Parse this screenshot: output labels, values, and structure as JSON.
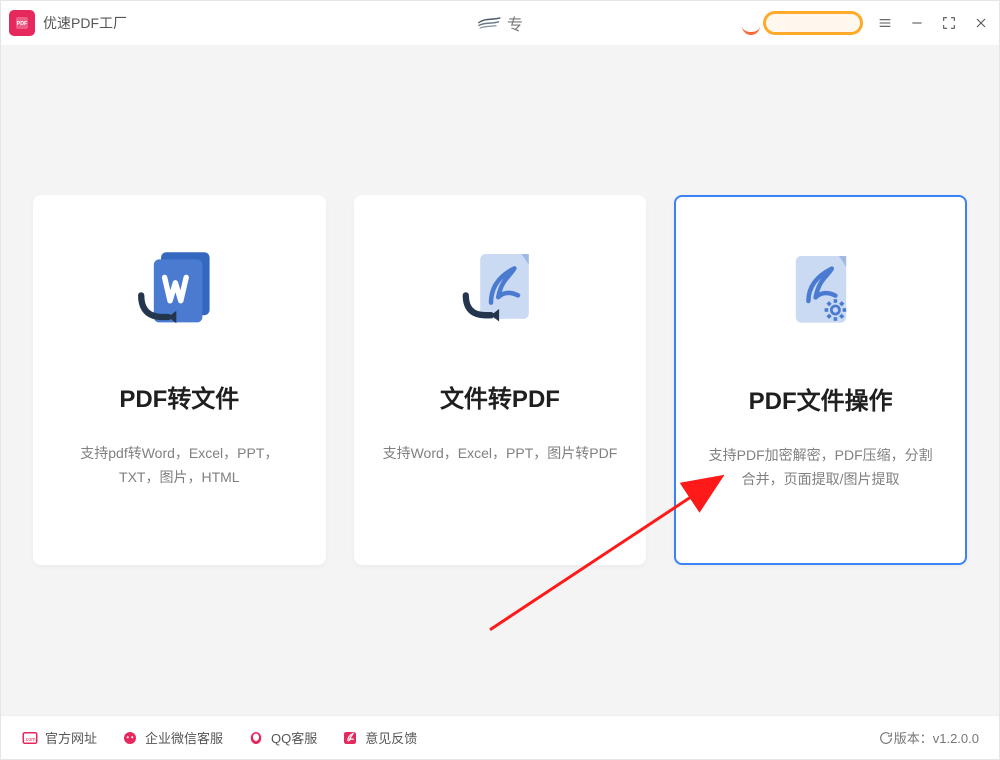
{
  "app": {
    "title": "优速PDF工厂"
  },
  "titlebar": {
    "center_text": "专",
    "vip_label": ""
  },
  "cards": [
    {
      "title": "PDF转文件",
      "desc": "支持pdf转Word，Excel，PPT，TXT，图片，HTML"
    },
    {
      "title": "文件转PDF",
      "desc": "支持Word，Excel，PPT，图片转PDF"
    },
    {
      "title": "PDF文件操作",
      "desc": "支持PDF加密解密，PDF压缩，分割合并，页面提取/图片提取"
    }
  ],
  "footer": {
    "links": [
      {
        "label": "官方网址"
      },
      {
        "label": "企业微信客服"
      },
      {
        "label": "QQ客服"
      },
      {
        "label": "意见反馈"
      }
    ],
    "version_label": "版本：",
    "version_value": "v1.2.0.0"
  }
}
